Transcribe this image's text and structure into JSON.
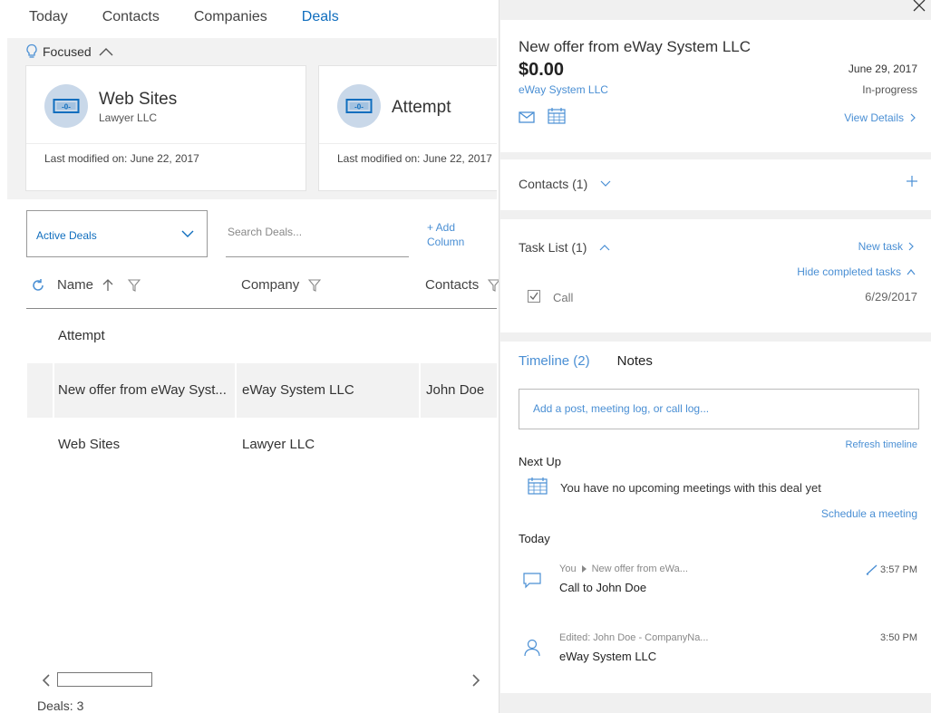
{
  "nav": {
    "tabs": [
      "Today",
      "Contacts",
      "Companies",
      "Deals"
    ],
    "active_tab": "Deals"
  },
  "focused": {
    "label": "Focused",
    "cards": [
      {
        "title": "Web Sites",
        "subtitle": "Lawyer LLC",
        "modified": "Last modified on: June 22, 2017"
      },
      {
        "title": "Attempt",
        "subtitle": "",
        "modified": "Last modified on: June 22, 2017"
      }
    ]
  },
  "filter": {
    "selected": "Active Deals"
  },
  "search": {
    "placeholder": "Search Deals..."
  },
  "add_column": {
    "label": "+ Add Column"
  },
  "grid": {
    "columns": [
      "Name",
      "Company",
      "Contacts"
    ],
    "rows": [
      {
        "name": "Attempt",
        "company": "",
        "contacts": ""
      },
      {
        "name": "New offer from eWay Syst...",
        "company": "eWay System LLC",
        "contacts": "John Doe"
      },
      {
        "name": "Web Sites",
        "company": "Lawyer LLC",
        "contacts": ""
      }
    ],
    "selected_row": 1
  },
  "footer": {
    "deals_count": "Deals: 3"
  },
  "detail": {
    "title": "New offer from eWay System LLC",
    "amount": "$0.00",
    "date": "June 29, 2017",
    "company": "eWay System LLC",
    "status": "In-progress",
    "view_details": "View Details",
    "contacts": {
      "title": "Contacts (1)"
    },
    "tasks": {
      "title": "Task List (1)",
      "new_task": "New task",
      "hide_completed": "Hide completed tasks",
      "items": [
        {
          "label": "Call",
          "date": "6/29/2017",
          "done": true
        }
      ]
    },
    "timeline": {
      "tabs": [
        "Timeline (2)",
        "Notes"
      ],
      "post_placeholder": "Add a post, meeting log, or call log...",
      "refresh": "Refresh timeline",
      "next_up_label": "Next Up",
      "next_up_text": "You have no upcoming meetings with this deal yet",
      "schedule": "Schedule a meeting",
      "today_label": "Today",
      "entries": [
        {
          "author": "You",
          "target": "New offer from eWa...",
          "text": "Call to John Doe",
          "time": "3:57 PM"
        },
        {
          "meta": "Edited: John Doe - CompanyNa...",
          "text": "eWay System LLC",
          "time": "3:50 PM"
        }
      ]
    }
  },
  "colors": {
    "accent": "#106ebe",
    "link": "#4a8fd4",
    "panel_bg": "#f0f0f0"
  }
}
